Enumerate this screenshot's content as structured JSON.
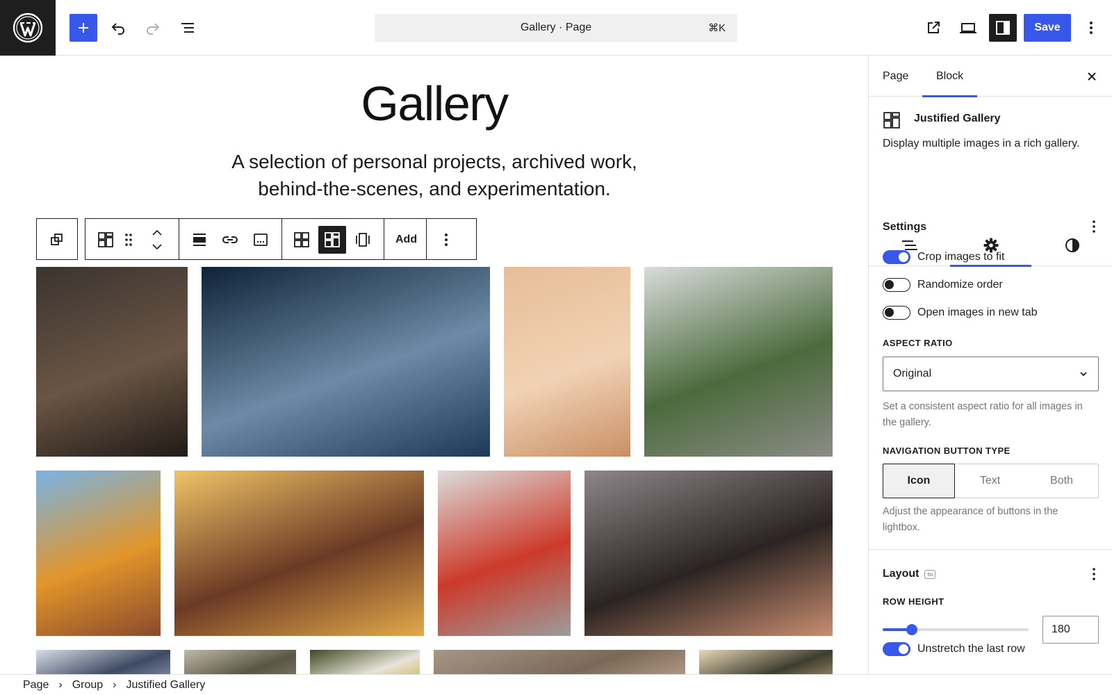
{
  "topbar": {
    "document_title": "Gallery · Page",
    "shortcut": "⌘K",
    "save_label": "Save"
  },
  "canvas": {
    "title": "Gallery",
    "subtitle_line1": "A selection of personal projects, archived work,",
    "subtitle_line2": "behind-the-scenes, and experimentation.",
    "toolbar": {
      "add_label": "Add"
    }
  },
  "gallery": {
    "images": [
      {
        "alt": "portrait-woman-dark-hair",
        "colors": [
          "#3a3430",
          "#1f1b18",
          "#6b5544"
        ]
      },
      {
        "alt": "jellyfish",
        "colors": [
          "#0f2338",
          "#1c3a58",
          "#6d8aa6"
        ]
      },
      {
        "alt": "desert-dunes",
        "colors": [
          "#e7bd97",
          "#c98f66",
          "#f1d2b4"
        ]
      },
      {
        "alt": "woman-sweater-forest",
        "colors": [
          "#d8dbdb",
          "#8b8b86",
          "#4b6b3c"
        ]
      },
      {
        "alt": "mesa-arch",
        "colors": [
          "#78b3e4",
          "#8a4a2e",
          "#e2952a"
        ]
      },
      {
        "alt": "woman-flower-crown",
        "colors": [
          "#f0c468",
          "#e3a94a",
          "#6b3a25"
        ]
      },
      {
        "alt": "climber-rock",
        "colors": [
          "#dcdcdc",
          "#9c9c9c",
          "#cc3a2a"
        ]
      },
      {
        "alt": "hiker-sunset",
        "colors": [
          "#8e8689",
          "#c98d70",
          "#2b2422"
        ]
      },
      {
        "alt": "row3-1",
        "colors": [
          "#d9dee7",
          "#9aa7bf",
          "#3e4a63"
        ]
      },
      {
        "alt": "row3-2",
        "colors": [
          "#bfb9a9",
          "#8b8471",
          "#5a5545"
        ]
      },
      {
        "alt": "row3-3",
        "colors": [
          "#3f4a22",
          "#c9a534",
          "#e7e3d8"
        ]
      },
      {
        "alt": "row3-4",
        "colors": [
          "#a69886",
          "#c2aa92",
          "#7c6857"
        ]
      },
      {
        "alt": "row3-5",
        "colors": [
          "#e8d8b6",
          "#c4a97a",
          "#3d3d2f"
        ]
      }
    ]
  },
  "breadcrumb": {
    "items": [
      "Page",
      "Group",
      "Justified Gallery"
    ],
    "separator": "›"
  },
  "sidebar": {
    "tabs": [
      "Page",
      "Block"
    ],
    "block_name": "Justified Gallery",
    "block_description": "Display multiple images in a rich gallery.",
    "settings": {
      "title": "Settings",
      "toggles": [
        {
          "label": "Crop images to fit",
          "on": true
        },
        {
          "label": "Randomize order",
          "on": false
        },
        {
          "label": "Open images in new tab",
          "on": false
        }
      ],
      "aspect_ratio_label": "ASPECT RATIO",
      "aspect_ratio_value": "Original",
      "aspect_ratio_help": "Set a consistent aspect ratio for all images in the gallery.",
      "nav_button_label": "NAVIGATION BUTTON TYPE",
      "nav_button_options": [
        "Icon",
        "Text",
        "Both"
      ],
      "nav_button_selected": "Icon",
      "nav_button_help": "Adjust the appearance of buttons in the lightbox."
    },
    "layout": {
      "title": "Layout",
      "badge": "tw",
      "row_height_label": "ROW HEIGHT",
      "row_height_value": "180",
      "row_height_fraction": 0.2,
      "unstretch_label": "Unstretch the last row",
      "unstretch_on": true
    }
  },
  "colors": {
    "accent": "#3858e9",
    "dark": "#1e1e1e",
    "border": "#e0e0e0",
    "muted": "#757575"
  }
}
